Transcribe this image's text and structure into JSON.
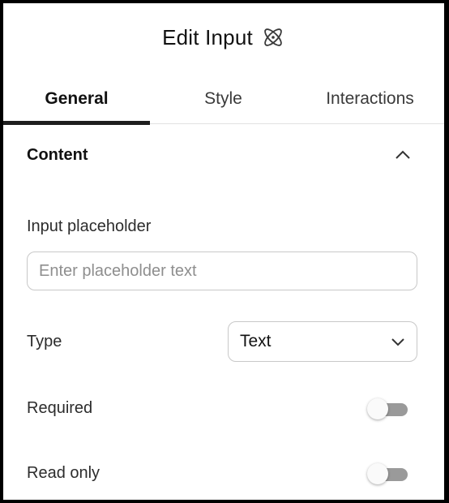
{
  "header": {
    "title": "Edit Input",
    "title_icon": "atom-icon"
  },
  "tabs": [
    {
      "label": "General",
      "active": true
    },
    {
      "label": "Style",
      "active": false
    },
    {
      "label": "Interactions",
      "active": false
    }
  ],
  "content_section": {
    "title": "Content",
    "collapse_icon": "chevron-up-icon",
    "placeholder_field": {
      "label": "Input placeholder",
      "value": "",
      "placeholder": "Enter placeholder text"
    },
    "type_field": {
      "label": "Type",
      "selected": "Text",
      "icon": "chevron-down-icon"
    },
    "required_toggle": {
      "label": "Required",
      "on": false
    },
    "read_only_toggle": {
      "label": "Read only",
      "on": false
    }
  },
  "colors": {
    "active_tab_indicator": "#1e1e1e",
    "toggle_track_off": "#9a9a9a",
    "border": "#c8c8c8"
  }
}
